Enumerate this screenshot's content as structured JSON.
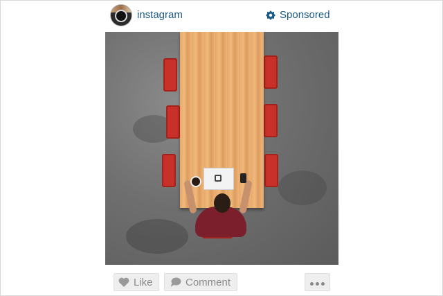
{
  "post": {
    "account": {
      "username": "instagram",
      "avatar_icon": "instagram-camera-avatar"
    },
    "sponsored": {
      "label": "Sponsored",
      "icon": "sponsored-badge-icon"
    },
    "photo": {
      "subject": "overhead-office-table-photo"
    }
  },
  "actions": {
    "like_label": "Like",
    "comment_label": "Comment",
    "more_icon": "more-dots-icon"
  },
  "colors": {
    "link_blue": "#1c5a86",
    "button_bg": "#eeeeee",
    "button_text": "#8a8a8a"
  }
}
